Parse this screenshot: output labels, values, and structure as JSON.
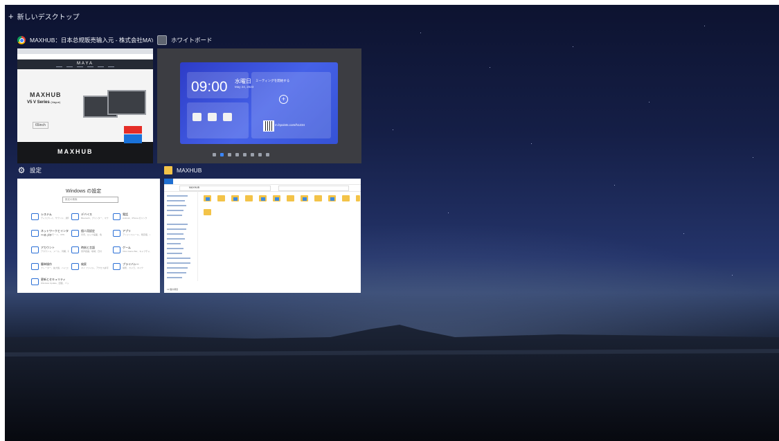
{
  "desktop_bar": {
    "new_desktop_label": "新しいデスクトップ"
  },
  "windows": [
    {
      "title": "MAXHUB：日本总规販売输入元 - 株式会社MAYA SYSTEM - Google...",
      "icon": "chrome-icon",
      "content": {
        "logo": "MAYA",
        "brand": "MAXHUB",
        "series": "V5 V Series",
        "series_sub": "(Vague)",
        "sizes": "65inch",
        "footer_brand": "MAXHUB"
      }
    },
    {
      "title": "ホワイトボード",
      "icon": "whiteboard-icon",
      "content": {
        "time": "09:00",
        "weekday": "水曜日",
        "date": "May 24, 2023",
        "meeting_label": "ミーティングを開始する",
        "url": "m.hpoints.com/h1234"
      }
    },
    {
      "title": "設定",
      "icon": "gear-icon",
      "content": {
        "heading": "Windows の設定",
        "search_placeholder": "設定の検索",
        "items": [
          {
            "label": "システム",
            "desc": "ディスプレイ、サウンド、通知、電源"
          },
          {
            "label": "デバイス",
            "desc": "Bluetooth、プリンター、マウス"
          },
          {
            "label": "電話",
            "desc": "Android、iPhone のリンク"
          },
          {
            "label": "ネットワークとインターネット",
            "desc": "Wi-Fi、機内モード、VPN"
          },
          {
            "label": "個人用設定",
            "desc": "背景、ロック画面、色"
          },
          {
            "label": "アプリ",
            "desc": "アンインストール、既定値、オプションの機能"
          },
          {
            "label": "アカウント",
            "desc": "アカウント、メール、同期、職場、家族"
          },
          {
            "label": "時刻と言語",
            "desc": "音声認識、地域、日付"
          },
          {
            "label": "ゲーム",
            "desc": "Xbox Game Bar、キャプチャ、ゲームモード"
          },
          {
            "label": "簡単操作",
            "desc": "ナレーター、拡大鏡、ハイコントラスト"
          },
          {
            "label": "検索",
            "desc": "マイ ファイル、アクセス許可"
          },
          {
            "label": "プライバシー",
            "desc": "場所、カメラ、マイク"
          },
          {
            "label": "更新とセキュリティ",
            "desc": "Windows Update、回復、バックアップ"
          }
        ]
      }
    },
    {
      "title": "MAXHUB",
      "icon": "folder-icon",
      "content": {
        "path": "MAXHUB",
        "status": "13 個の項目"
      }
    }
  ],
  "colors": {
    "accent": "#1a72d9",
    "red_button": "#e52d27",
    "whiteboard_blue": "#3552d6"
  }
}
